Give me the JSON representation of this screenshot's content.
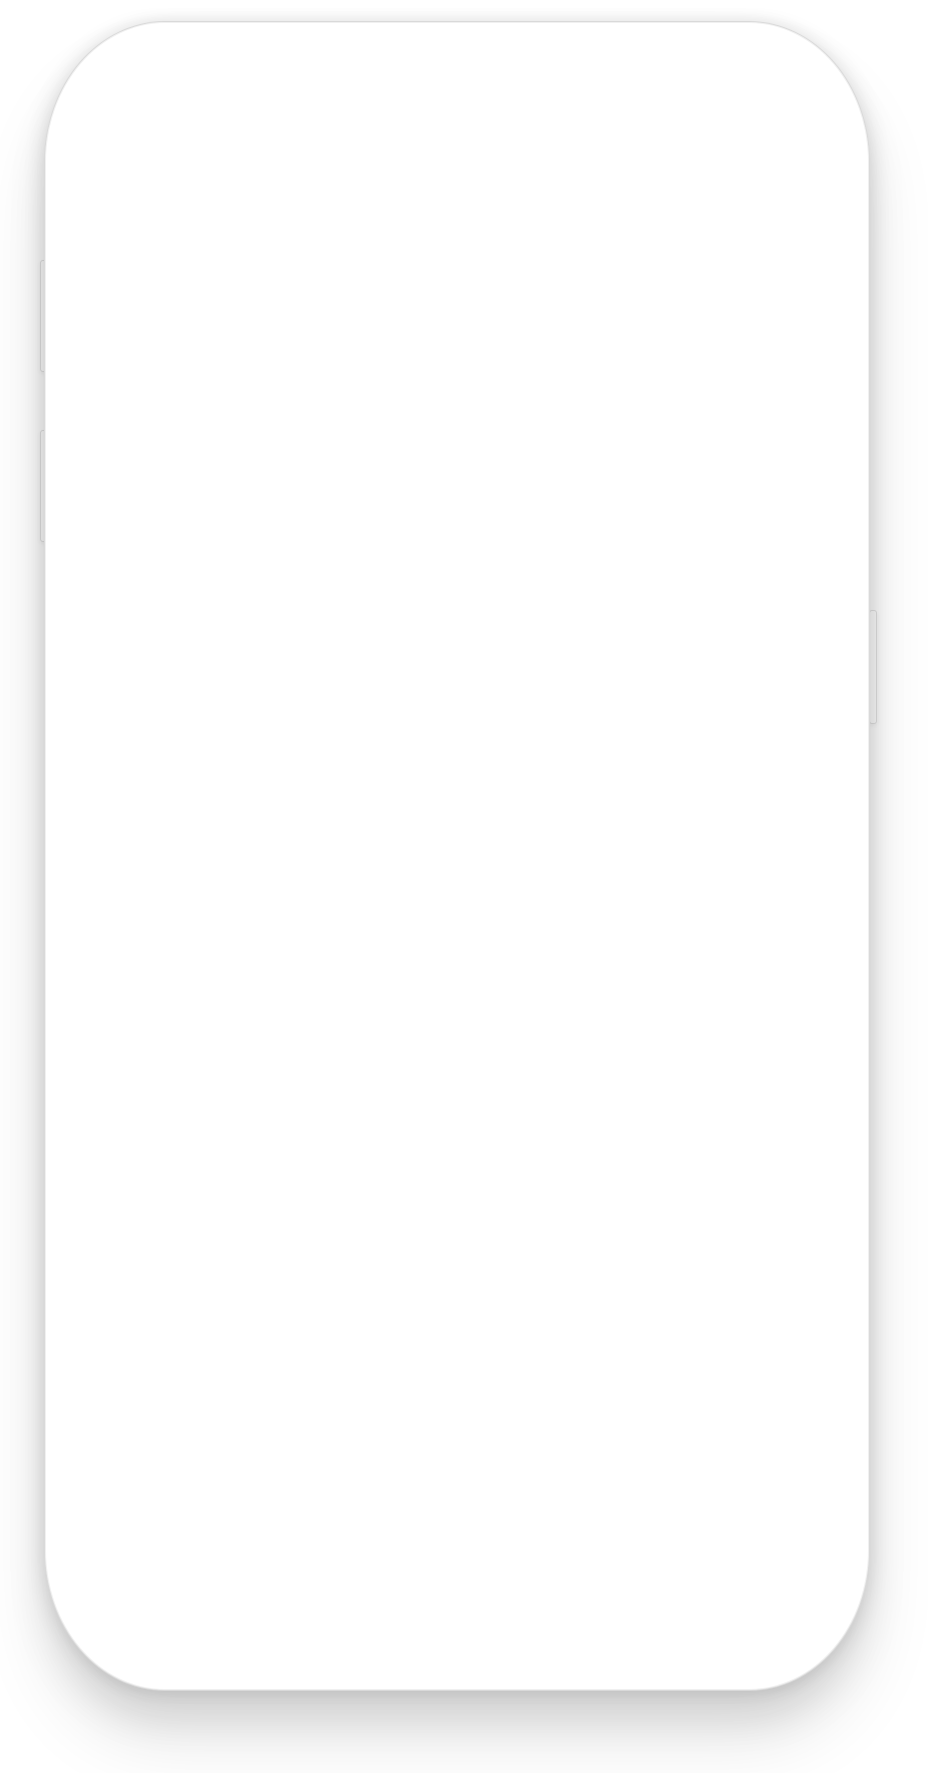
{
  "device": {
    "type": "smartphone",
    "screen_content": "",
    "colors": {
      "body": "#ffffff",
      "edge": "#d9d9d9",
      "screen": "#ffffff"
    }
  }
}
